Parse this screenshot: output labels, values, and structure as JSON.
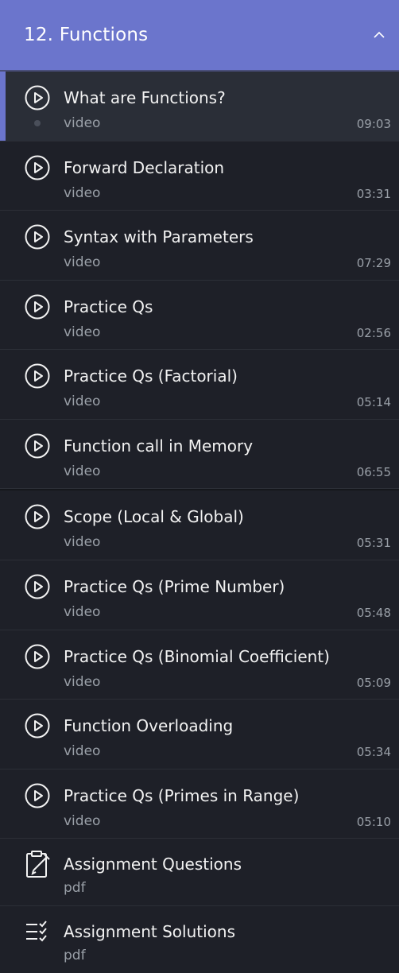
{
  "section": {
    "title": "12. Functions",
    "collapse_icon": "chevron-up-icon"
  },
  "lessons": [
    {
      "title": "What are Functions?",
      "type": "video",
      "duration": "09:03",
      "icon": "play-circle-icon",
      "active": true
    },
    {
      "title": "Forward Declaration",
      "type": "video",
      "duration": "03:31",
      "icon": "play-circle-icon"
    },
    {
      "title": "Syntax with Parameters",
      "type": "video",
      "duration": "07:29",
      "icon": "play-circle-icon"
    },
    {
      "title": "Practice Qs",
      "type": "video",
      "duration": "02:56",
      "icon": "play-circle-icon"
    },
    {
      "title": "Practice Qs (Factorial)",
      "type": "video",
      "duration": "05:14",
      "icon": "play-circle-icon"
    },
    {
      "title": "Function call in Memory",
      "type": "video",
      "duration": "06:55",
      "icon": "play-circle-icon"
    },
    {
      "title": "Scope (Local & Global)",
      "type": "video",
      "duration": "05:31",
      "icon": "play-circle-icon"
    },
    {
      "title": "Practice Qs (Prime Number)",
      "type": "video",
      "duration": "05:48",
      "icon": "play-circle-icon"
    },
    {
      "title": "Practice Qs (Binomial Coefficient)",
      "type": "video",
      "duration": "05:09",
      "icon": "play-circle-icon"
    },
    {
      "title": "Function Overloading",
      "type": "video",
      "duration": "05:34",
      "icon": "play-circle-icon"
    },
    {
      "title": "Practice Qs (Primes in Range)",
      "type": "video",
      "duration": "05:10",
      "icon": "play-circle-icon"
    }
  ],
  "resources": [
    {
      "title": "Assignment Questions",
      "type": "pdf",
      "icon": "edit-document-icon"
    },
    {
      "title": "Assignment Solutions",
      "type": "pdf",
      "icon": "checklist-icon"
    }
  ],
  "colors": {
    "accent": "#6b75cc",
    "background": "#1e2028",
    "active_background": "#2a2e37"
  }
}
